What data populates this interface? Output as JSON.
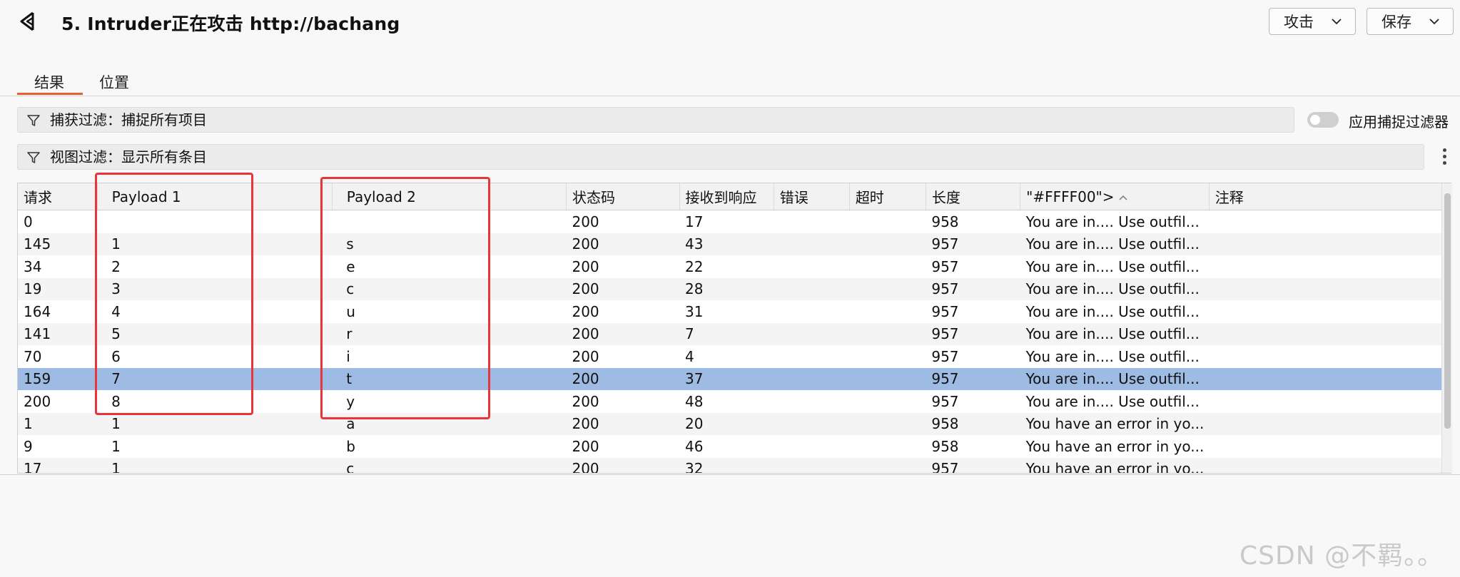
{
  "window": {
    "title": "5. Intruder正在攻击 http://bachang",
    "attack_button": "攻击",
    "save_button": "保存"
  },
  "tabs": [
    {
      "label": "结果",
      "active": true
    },
    {
      "label": "位置",
      "active": false
    }
  ],
  "filters": {
    "capture": "捕获过滤：捕捉所有项目",
    "view": "视图过滤：显示所有条目",
    "apply_capture_toggle_label": "应用捕捉过滤器",
    "apply_capture_toggle_on": false
  },
  "table": {
    "columns": [
      "请求",
      "Payload 1",
      "Payload 2",
      "状态码",
      "接收到响应",
      "错误",
      "超时",
      "长度",
      "\"#FFFF00\">",
      "注释"
    ],
    "sorted_column": "\"#FFFF00\">",
    "rows": [
      {
        "req": "0",
        "p1": "",
        "p2": "",
        "status": "200",
        "recv": "17",
        "len": "958",
        "ffff": "You are in.... Use outfil...",
        "selected": false
      },
      {
        "req": "145",
        "p1": "1",
        "p2": "s",
        "status": "200",
        "recv": "43",
        "len": "957",
        "ffff": "You are in.... Use outfil...",
        "selected": false
      },
      {
        "req": "34",
        "p1": "2",
        "p2": "e",
        "status": "200",
        "recv": "22",
        "len": "957",
        "ffff": "You are in.... Use outfil...",
        "selected": false
      },
      {
        "req": "19",
        "p1": "3",
        "p2": "c",
        "status": "200",
        "recv": "28",
        "len": "957",
        "ffff": "You are in.... Use outfil...",
        "selected": false
      },
      {
        "req": "164",
        "p1": "4",
        "p2": "u",
        "status": "200",
        "recv": "31",
        "len": "957",
        "ffff": "You are in.... Use outfil...",
        "selected": false
      },
      {
        "req": "141",
        "p1": "5",
        "p2": "r",
        "status": "200",
        "recv": "7",
        "len": "957",
        "ffff": "You are in.... Use outfil...",
        "selected": false
      },
      {
        "req": "70",
        "p1": "6",
        "p2": "i",
        "status": "200",
        "recv": "4",
        "len": "957",
        "ffff": "You are in.... Use outfil...",
        "selected": false
      },
      {
        "req": "159",
        "p1": "7",
        "p2": "t",
        "status": "200",
        "recv": "37",
        "len": "957",
        "ffff": "You are in.... Use outfil...",
        "selected": true
      },
      {
        "req": "200",
        "p1": "8",
        "p2": "y",
        "status": "200",
        "recv": "48",
        "len": "957",
        "ffff": "You are in.... Use outfil...",
        "selected": false
      },
      {
        "req": "1",
        "p1": "1",
        "p2": "a",
        "status": "200",
        "recv": "20",
        "len": "958",
        "ffff": "You have an error in yo...",
        "selected": false
      },
      {
        "req": "9",
        "p1": "1",
        "p2": "b",
        "status": "200",
        "recv": "46",
        "len": "958",
        "ffff": "You have an error in yo...",
        "selected": false
      },
      {
        "req": "17",
        "p1": "1",
        "p2": "c",
        "status": "200",
        "recv": "32",
        "len": "957",
        "ffff": "You have an error in yo...",
        "selected": false
      }
    ]
  },
  "annotations": {
    "color": "#e8353a"
  },
  "watermark": "CSDN @不羁。。",
  "colors": {
    "accent": "#e8612c",
    "selected_row": "#9dbbe3"
  }
}
